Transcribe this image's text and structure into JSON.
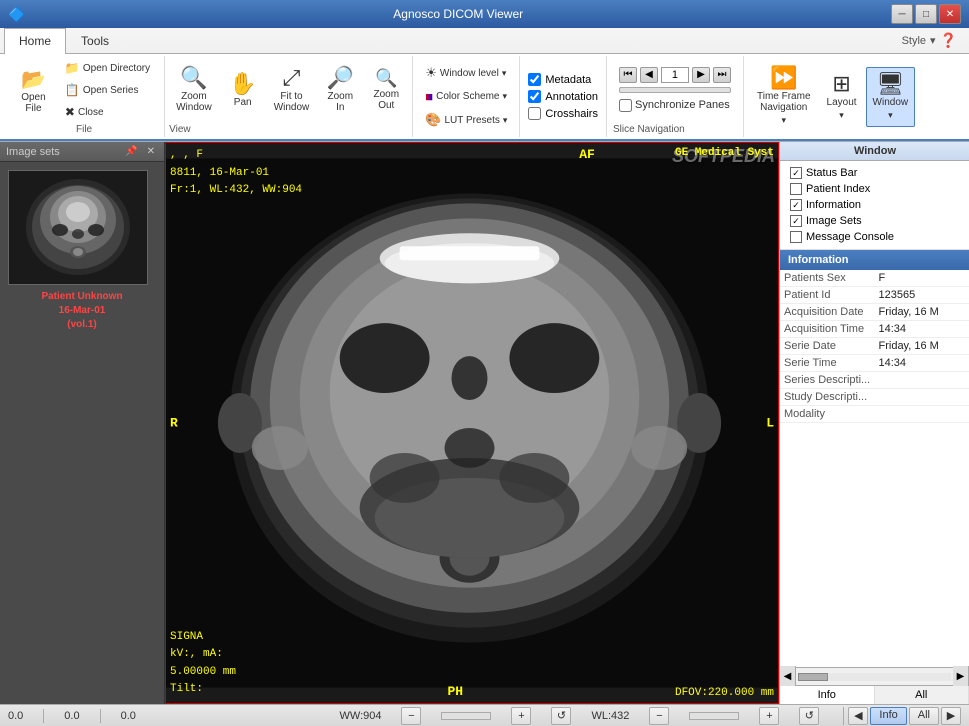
{
  "app": {
    "title": "Agnosco DICOM Viewer",
    "style_label": "Style",
    "softpedia": "SOFTPEDIA"
  },
  "title_controls": {
    "minimize": "─",
    "maximize": "□",
    "close": "✕"
  },
  "ribbon": {
    "tabs": [
      {
        "id": "home",
        "label": "Home",
        "active": true
      },
      {
        "id": "tools",
        "label": "Tools",
        "active": false
      }
    ],
    "file_group_label": "File",
    "open_file_label": "Open\nFile",
    "open_directory_label": "Open Directory",
    "open_series_label": "Open Series",
    "close_label": "Close",
    "view_group_label": "View",
    "zoom_window_label": "Zoom\nWindow",
    "pan_label": "Pan",
    "fit_to_window_label": "Fit to\nWindow",
    "zoom_in_label": "Zoom\nIn",
    "zoom_out_label": "Zoom\nOut",
    "window_level_label": "Window level",
    "color_scheme_label": "Color Scheme",
    "lut_presets_label": "LUT Presets",
    "metadata_label": "Metadata",
    "annotation_label": "Annotation",
    "crosshairs_label": "Crosshairs",
    "time_frame_nav_label": "Time Frame\nNavigation",
    "layout_label": "Layout",
    "window_label": "Window",
    "slice_nav_group_label": "Slice Navigation",
    "frame_number": "1",
    "sync_panes_label": "Synchronize Panes"
  },
  "image_sets": {
    "panel_label": "Image sets",
    "patient_label": "Patient Unknown",
    "patient_date": "16-Mar-01",
    "patient_vol": "(vol.1)"
  },
  "viewer": {
    "overlay_tl_line1": ", , F",
    "overlay_tl_line2": "8811, 16-Mar-01",
    "overlay_tl_line3": "Fr:1, WL:432, WW:904",
    "overlay_tr": "GE Medical Syst",
    "overlay_bl_line1": "SIGNA",
    "overlay_bl_line2": "kV:, mA:",
    "overlay_bl_line3": "5.00000 mm",
    "overlay_bl_line4": "Tilt:",
    "overlay_br": "DFOV:220.000 mm",
    "label_r": "R",
    "label_l": "L",
    "label_af": "AF",
    "label_ph": "PH"
  },
  "window_dropdown": {
    "title": "Window",
    "items": [
      {
        "id": "status_bar",
        "label": "Status Bar",
        "checked": true
      },
      {
        "id": "patient_index",
        "label": "Patient Index",
        "checked": false
      },
      {
        "id": "information",
        "label": "Information",
        "checked": true
      },
      {
        "id": "image_sets",
        "label": "Image Sets",
        "checked": true
      },
      {
        "id": "message_console",
        "label": "Message Console",
        "checked": false
      }
    ]
  },
  "info_panel": {
    "title": "Information",
    "rows": [
      {
        "label": "Patients Sex",
        "value": "F"
      },
      {
        "label": "Patient Id",
        "value": "123565"
      },
      {
        "label": "Acquisition Date",
        "value": "Friday, 16 M"
      },
      {
        "label": "Acquisition Time",
        "value": "14:34"
      },
      {
        "label": "Serie Date",
        "value": "Friday, 16 M"
      },
      {
        "label": "Serie Time",
        "value": "14:34"
      },
      {
        "label": "Series Descripti...",
        "value": ""
      },
      {
        "label": "Study Descripti...",
        "value": ""
      },
      {
        "label": "Modality",
        "value": ""
      }
    ],
    "tab_info": "Info",
    "tab_all": "All"
  },
  "status_bar": {
    "x": "0.0",
    "y": "0.0",
    "z": "0.0",
    "ww_label": "WW:904",
    "wl_label": "WL:432"
  },
  "bottom_bar": {
    "info_label": "Info",
    "all_label": "All"
  },
  "checkboxes": {
    "metadata": true,
    "annotation": true,
    "crosshairs": false
  }
}
